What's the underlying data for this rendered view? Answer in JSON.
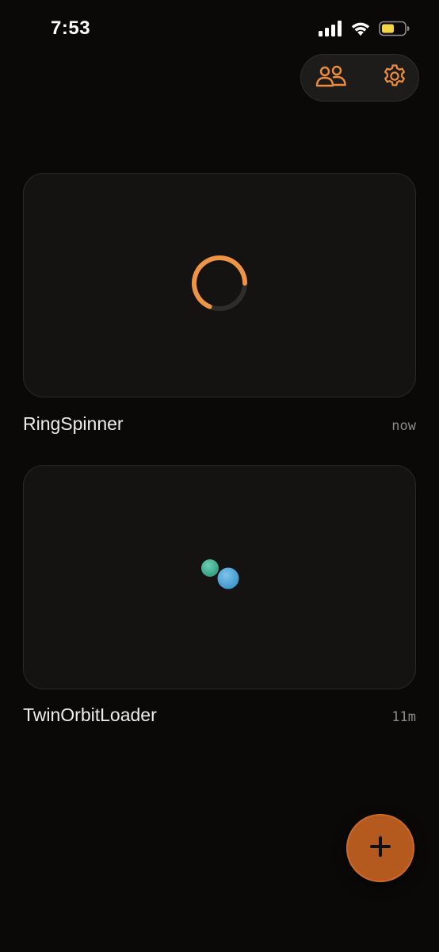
{
  "status_bar": {
    "time": "7:53",
    "icons": [
      "cellular-signal-icon",
      "wifi-icon",
      "battery-icon"
    ],
    "battery_color": "#f4d548"
  },
  "toolbar": {
    "buttons": [
      "people-icon",
      "gear-icon"
    ],
    "accent_color": "#ef8d3e"
  },
  "components": [
    {
      "name": "RingSpinner",
      "updated": "now",
      "preview": "ring-spinner",
      "colors": {
        "arc": "#ef9344",
        "track": "#2e2d2c"
      }
    },
    {
      "name": "TwinOrbitLoader",
      "updated": "11m",
      "preview": "twin-orbit",
      "colors": {
        "dot_a": "#3fae92",
        "dot_b": "#4fa8d8"
      }
    }
  ],
  "fab": {
    "icon": "plus-icon",
    "color": "#b45a1f"
  }
}
